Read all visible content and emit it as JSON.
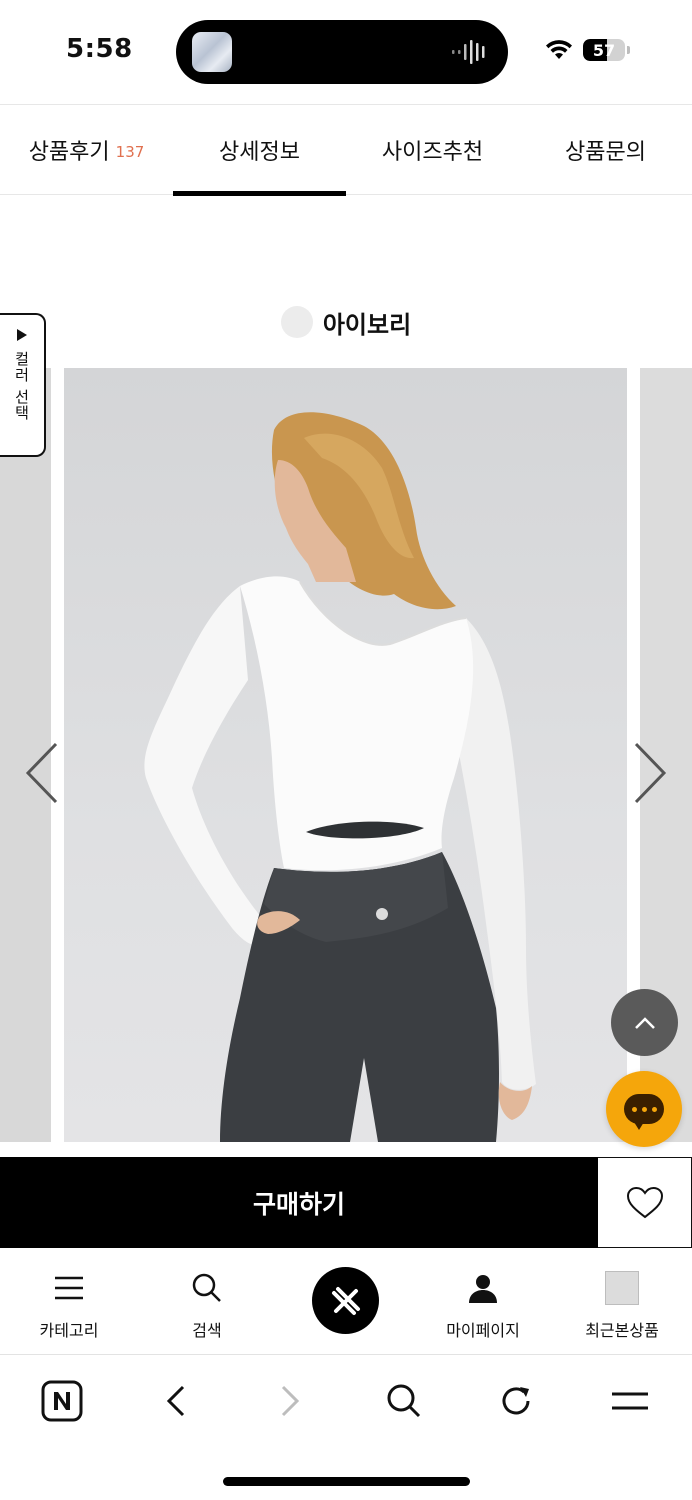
{
  "status_bar": {
    "time": "5:58",
    "battery_level": "57",
    "icons": [
      "wifi-icon",
      "battery-icon",
      "audio-wave-icon"
    ]
  },
  "tabs": [
    {
      "label": "상품후기",
      "count": "137",
      "active": false
    },
    {
      "label": "상세정보",
      "active": true
    },
    {
      "label": "사이즈추천",
      "active": false
    },
    {
      "label": "상품문의",
      "active": false
    }
  ],
  "product": {
    "color_name": "아이보리",
    "color_swatch": "#ececec",
    "color_select_label": "컬러 선택"
  },
  "actions": {
    "buy_label": "구매하기"
  },
  "bottom_nav": [
    {
      "label": "카테고리",
      "icon": "menu-icon"
    },
    {
      "label": "검색",
      "icon": "search-icon"
    },
    {
      "label": "",
      "icon": "brand-logo-icon"
    },
    {
      "label": "마이페이지",
      "icon": "person-icon"
    },
    {
      "label": "최근본상품",
      "icon": "recent-product-thumbnail"
    }
  ],
  "browser_bar": {
    "icons": [
      "naver-home-icon",
      "back-icon",
      "forward-icon",
      "search-icon",
      "reload-icon",
      "menu-icon"
    ]
  },
  "colors": {
    "accent_count": "#e0704f",
    "chat_button": "#f5a60b",
    "buy_button": "#000000"
  }
}
